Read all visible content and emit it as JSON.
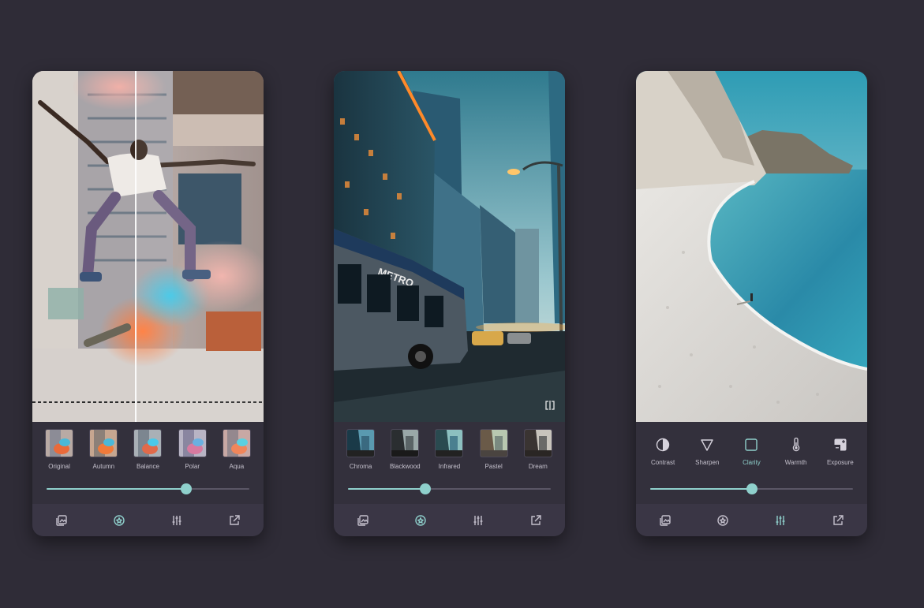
{
  "colors": {
    "background": "#2f2c37",
    "panel": "#33303c",
    "navbar": "#3a3645",
    "accent": "#8fd0cc",
    "label": "#c4c0cc",
    "track": "#5a5666"
  },
  "screens": [
    {
      "photo_subject": "skateboarder-with-colored-smoke",
      "filters": [
        {
          "label": "Original"
        },
        {
          "label": "Autumn"
        },
        {
          "label": "Balance"
        },
        {
          "label": "Polar"
        },
        {
          "label": "Aqua"
        }
      ],
      "slider": {
        "value": 0.69
      },
      "nav_icons": [
        "gallery-icon",
        "filters-icon",
        "adjust-icon",
        "share-icon"
      ],
      "nav_active": "filters-icon"
    },
    {
      "photo_subject": "city-street-with-metro-bus",
      "filters": [
        {
          "label": "Chroma"
        },
        {
          "label": "Blackwood"
        },
        {
          "label": "Infrared"
        },
        {
          "label": "Pastel"
        },
        {
          "label": "Dream"
        }
      ],
      "slider": {
        "value": 0.38
      },
      "nav_icons": [
        "gallery-icon",
        "filters-icon",
        "adjust-icon",
        "share-icon"
      ],
      "nav_active": "filters-icon",
      "compare_icon": "compare-icon"
    },
    {
      "photo_subject": "beach-with-cliffs",
      "tools": [
        {
          "label": "Contrast",
          "icon": "contrast-icon"
        },
        {
          "label": "Sharpen",
          "icon": "sharpen-icon"
        },
        {
          "label": "Clarity",
          "icon": "clarity-icon",
          "active": true
        },
        {
          "label": "Warmth",
          "icon": "warmth-icon"
        },
        {
          "label": "Exposure",
          "icon": "exposure-icon"
        }
      ],
      "slider": {
        "value": 0.5
      },
      "nav_icons": [
        "gallery-icon",
        "filters-icon",
        "adjust-icon",
        "share-icon"
      ],
      "nav_active": "adjust-icon"
    }
  ]
}
